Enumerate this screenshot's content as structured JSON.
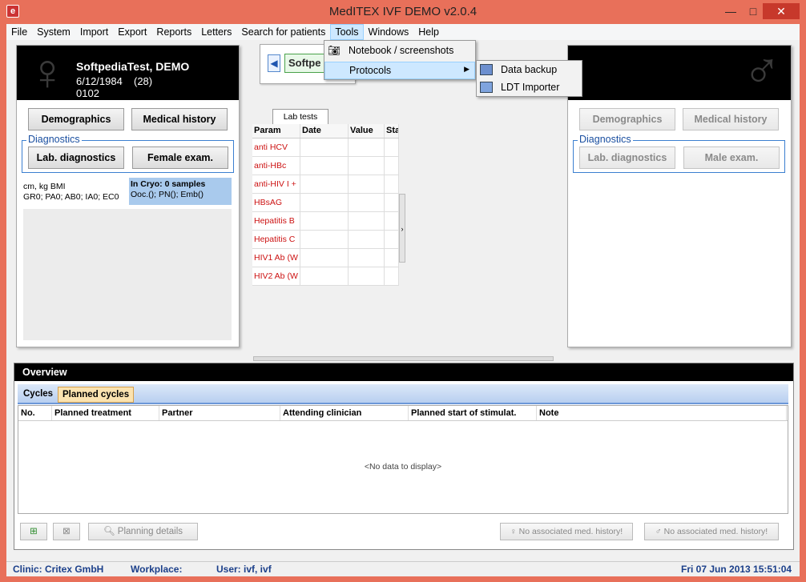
{
  "window": {
    "title": "MedITEX IVF DEMO v2.0.4",
    "minimize": "—",
    "maximize": "□",
    "close": "✕"
  },
  "menubar": [
    "File",
    "System",
    "Import",
    "Export",
    "Reports",
    "Letters",
    "Search for patients",
    "Tools",
    "Windows",
    "Help"
  ],
  "tools_menu": {
    "items": [
      "Notebook / screenshots",
      "Protocols"
    ]
  },
  "protocols_submenu": {
    "items": [
      "Data backup",
      "LDT Importer"
    ]
  },
  "female": {
    "name": "SoftpediaTest, DEMO",
    "dob": "6/12/1984",
    "age": "(28)",
    "id": "0102",
    "demographics": "Demographics",
    "medical_history": "Medical history",
    "diagnostics_label": "Diagnostics",
    "lab_diagnostics": "Lab. diagnostics",
    "exam": "Female exam.",
    "bmi_line": "cm, kg BMI",
    "gravida_line": "GR0; PA0; AB0; IA0; EC0",
    "cryo_title": "In Cryo: 0 samples",
    "cryo_detail": "Ooc.(); PN(); Emb()"
  },
  "male": {
    "demographics": "Demographics",
    "medical_history": "Medical history",
    "diagnostics_label": "Diagnostics",
    "lab_diagnostics": "Lab. diagnostics",
    "exam": "Male exam."
  },
  "search": {
    "value": "Softpe"
  },
  "lab_tests": {
    "tab": "Lab tests",
    "columns": [
      "Param",
      "Date",
      "Value",
      "Sta"
    ],
    "rows": [
      "anti HCV",
      "anti-HBc",
      "anti-HIV I +",
      "HBsAG",
      "Hepatitis B",
      "Hepatitis C",
      "HIV1 Ab (W",
      "HIV2 Ab (W"
    ]
  },
  "overview": {
    "title": "Overview",
    "tabs": [
      "Cycles",
      "Planned cycles"
    ],
    "columns": [
      "No.",
      "Planned treatment",
      "Partner",
      "Attending clinician",
      "Planned start of stimulat.",
      "Note"
    ],
    "empty": "<No data to display>",
    "planning_details": "Planning details",
    "female_no_history": "No associated med. history!",
    "male_no_history": "No associated med. history!"
  },
  "status": {
    "clinic": "Clinic: Critex GmbH",
    "workplace": "Workplace:",
    "user": "User: ivf, ivf",
    "datetime": "Fri 07 Jun 2013 15:51:04"
  }
}
